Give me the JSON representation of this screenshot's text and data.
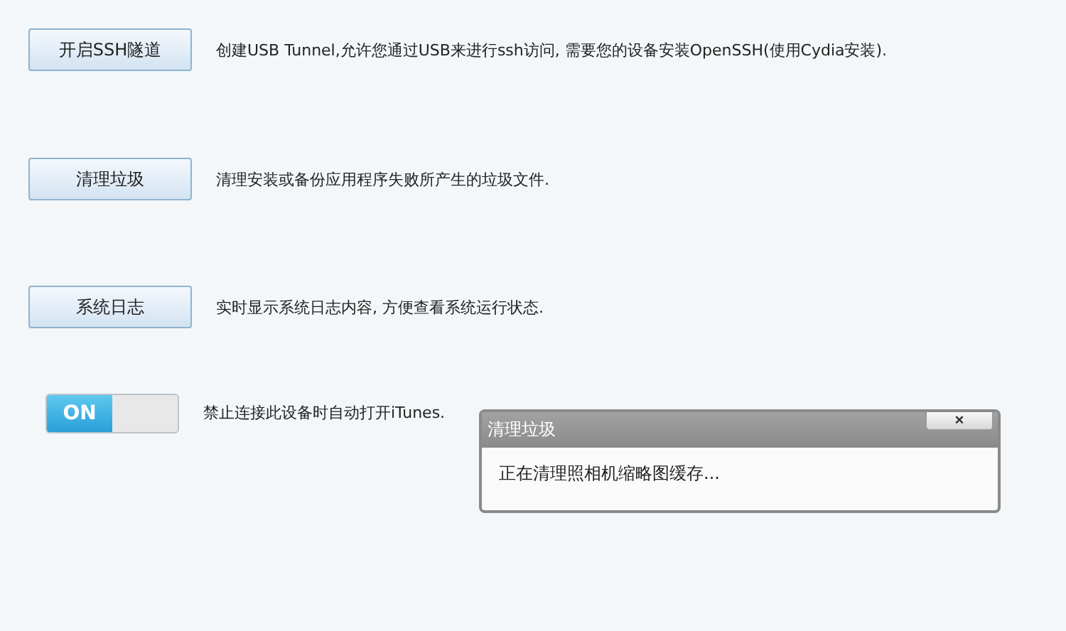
{
  "actions": [
    {
      "button": "开启SSH隧道",
      "description": "创建USB Tunnel,允许您通过USB来进行ssh访问, 需要您的设备安装OpenSSH(使用Cydia安装)."
    },
    {
      "button": "清理垃圾",
      "description": "清理安装或备份应用程序失败所产生的垃圾文件."
    },
    {
      "button": "系统日志",
      "description": "实时显示系统日志内容, 方便查看系统运行状态."
    }
  ],
  "toggle": {
    "label": "ON",
    "on": true,
    "description": "禁止连接此设备时自动打开iTunes."
  },
  "dialog": {
    "title": "清理垃圾",
    "close": "×",
    "message": "正在清理照相机缩略图缓存..."
  }
}
